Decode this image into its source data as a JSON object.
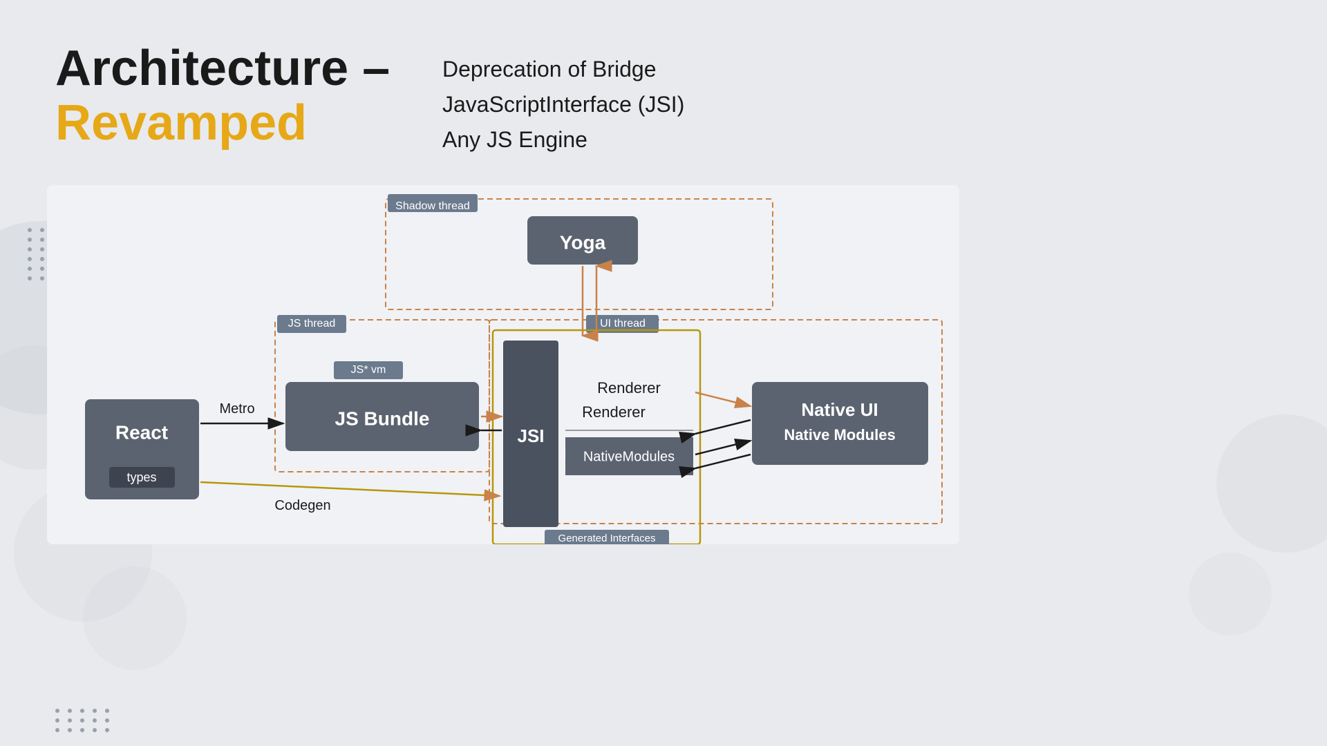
{
  "title": {
    "line1": "Architecture –",
    "line2": "Revamped"
  },
  "bullets": [
    "Deprecation of Bridge",
    "JavaScriptInterface (JSI)",
    "Any JS Engine"
  ],
  "diagram": {
    "nodes": {
      "react": "React",
      "react_sub": "types",
      "jsbundle": "JS Bundle",
      "jsvm_label": "JS* vm",
      "jsi": "JSI",
      "renderer": "Renderer",
      "nativemodules": "NativeModules",
      "yoga": "Yoga",
      "nativeui": "Native UI\nNative Modules"
    },
    "labels": {
      "metro": "Metro",
      "codegen": "Codegen",
      "js_thread": "JS thread",
      "ui_thread": "UI thread",
      "shadow_thread": "Shadow thread",
      "generated_interfaces": "Generated Interfaces"
    }
  }
}
